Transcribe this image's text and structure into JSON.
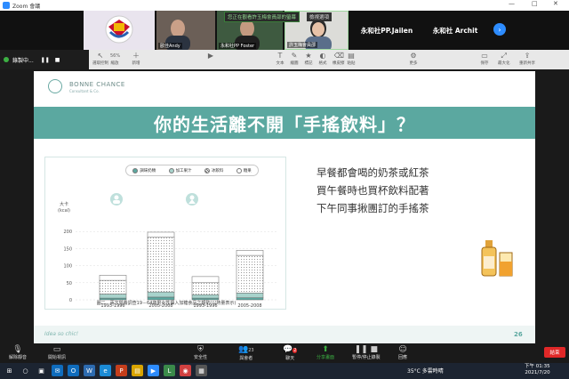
{
  "window": {
    "title": "Zoom 會議",
    "app_icon": "zoom-icon"
  },
  "participants": [
    {
      "name": "",
      "kind": "logo"
    },
    {
      "name": "歐佳Andy",
      "kind": "video"
    },
    {
      "name": "永和社PP Foster",
      "kind": "video"
    },
    {
      "name": "許玉梅會員邵",
      "kind": "video"
    },
    {
      "name": "永和社PP.Jailen",
      "kind": "name"
    },
    {
      "name": "永和社 Archit",
      "kind": "name"
    }
  ],
  "banner": {
    "viewing": "您正在觀看許玉梅會員邵的螢幕",
    "view_options": "檢視選項"
  },
  "share_bar": {
    "title": "錄製中...",
    "zoom_level": "56%",
    "tools": [
      "選取控制",
      "連結",
      "縮放",
      "新增",
      "...",
      "",
      "",
      "文本",
      "繪圖",
      "標記",
      "格式",
      "橡皮擦",
      "粘貼",
      "更多",
      "保存",
      "",
      "最大化",
      "重新共享",
      "全部"
    ]
  },
  "slide": {
    "brand": "BONNE CHANCE",
    "brand_sub": "Consultant & Co.",
    "heading": "你的生活離不開「手搖飲料」？",
    "bullets": [
      "早餐都會喝的奶茶或紅茶",
      "買午餐時也買杯飲料配著",
      "下午同事揪團訂的手搖茶"
    ],
    "footer": "Idea so chic!",
    "page_number": "26"
  },
  "chart_data": {
    "type": "bar",
    "stacked": true,
    "title": "",
    "caption": "圖二．兩次營養調查19－64歲男女性攝入加糖食品之趨勢(以熱量表示)",
    "ylabel": "大卡\n(kcal)",
    "ylim": [
      0,
      250
    ],
    "yticks": [
      0,
      50,
      100,
      150,
      200
    ],
    "legend": [
      "調味奶類",
      "加工果汁",
      "冰飲料",
      "糖果"
    ],
    "groups": [
      {
        "label": "男性",
        "categories": [
          "1993-1996",
          "2005-2008"
        ]
      },
      {
        "label": "女性",
        "categories": [
          "1993-1996",
          "2005-2008"
        ]
      }
    ],
    "categories": [
      "1993-1996",
      "2005-2008",
      "1993-1996",
      "2005-2008"
    ],
    "series": [
      {
        "name": "調味奶類",
        "values": [
          5,
          8,
          5,
          6
        ]
      },
      {
        "name": "加工果汁",
        "values": [
          12,
          15,
          10,
          14
        ]
      },
      {
        "name": "冰飲料",
        "values": [
          40,
          160,
          35,
          110
        ]
      },
      {
        "name": "糖果",
        "values": [
          15,
          15,
          18,
          15
        ]
      }
    ],
    "grid": true,
    "legend_position": "top"
  },
  "control_bar": {
    "mute": "解除靜音",
    "video": "開始視訊",
    "security": "安全性",
    "participants": "與會者",
    "participants_count": "23",
    "chat": "聊天",
    "chat_badge": "2",
    "share": "分享畫面",
    "pause_share": "暫停/停止錄製",
    "reactions": "回應",
    "leave": "結束"
  },
  "taskbar": {
    "weather": "35°C 多雲時晴",
    "time": "下午 01:35",
    "date": "2021/7/20"
  }
}
